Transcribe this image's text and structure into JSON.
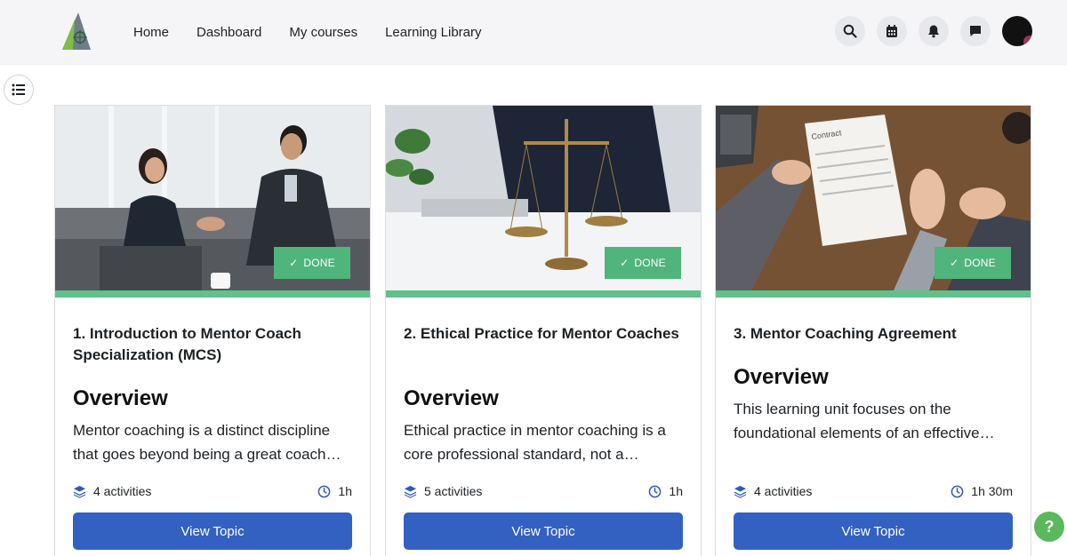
{
  "nav": {
    "links": [
      "Home",
      "Dashboard",
      "My courses",
      "Learning Library"
    ]
  },
  "icons": {
    "search": "search-icon",
    "calendar": "calendar-icon",
    "notifications": "bell-icon",
    "messages": "chat-icon",
    "drawer": "list-icon",
    "help": "?"
  },
  "colors": {
    "accent": "#3361c2",
    "done": "#4fb57b",
    "progress": "#62c08a",
    "help": "#5bb85d"
  },
  "cards": [
    {
      "badge": "DONE",
      "title": "1. Introduction to Mentor Coach Specialization (MCS)",
      "overview": "Overview",
      "description": "Mentor coaching is a distinct discipline that goes beyond being a great coach…",
      "activities": "4 activities",
      "duration": "1h",
      "button": "View Topic",
      "progress": 1.0
    },
    {
      "badge": "DONE",
      "title": "2. Ethical Practice for Mentor Coaches",
      "overview": "Overview",
      "description": "Ethical practice in mentor coaching is a core professional standard, not a…",
      "activities": "5 activities",
      "duration": "1h",
      "button": "View Topic",
      "progress": 1.0
    },
    {
      "badge": "DONE",
      "title": "3. Mentor Coaching Agreement",
      "overview": "Overview",
      "description": "This learning unit focuses on the foundational elements of an effective…",
      "activities": "4 activities",
      "duration": "1h 30m",
      "button": "View Topic",
      "progress": 1.0
    }
  ]
}
